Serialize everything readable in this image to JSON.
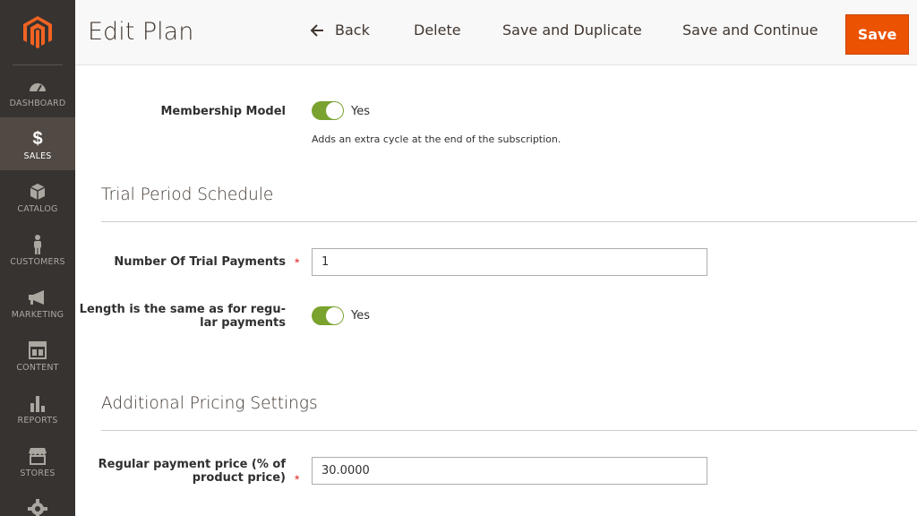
{
  "sidebar": {
    "logo": "magento-logo",
    "items": [
      {
        "label": "DASHBOARD",
        "icon": "dashboard-gauge-icon"
      },
      {
        "label": "SALES",
        "icon": "dollar-icon"
      },
      {
        "label": "CATALOG",
        "icon": "box-icon"
      },
      {
        "label": "CUSTOMERS",
        "icon": "person-icon"
      },
      {
        "label": "MARKETING",
        "icon": "megaphone-icon"
      },
      {
        "label": "CONTENT",
        "icon": "layout-icon"
      },
      {
        "label": "REPORTS",
        "icon": "bar-chart-icon"
      },
      {
        "label": "STORES",
        "icon": "storefront-icon"
      },
      {
        "label": "",
        "icon": "gear-icon"
      }
    ],
    "active_index": 1
  },
  "header": {
    "title": "Edit Plan",
    "back_label": "Back",
    "delete_label": "Delete",
    "save_duplicate_label": "Save and Duplicate",
    "save_continue_label": "Save and Continue",
    "save_label": "Save"
  },
  "form": {
    "membership": {
      "label": "Membership Model",
      "toggle_value": "Yes",
      "note": "Adds an extra cycle at the end of the subscription."
    },
    "trial_section": {
      "title": "Trial Period Schedule",
      "trial_payments_label": "Number Of Trial Payments",
      "trial_payments_value": "1",
      "length_label_line1": "Length is the same as for regu-",
      "length_label_line2": "lar payments",
      "length_toggle_value": "Yes"
    },
    "pricing_section": {
      "title": "Additional Pricing Settings",
      "regular_price_label_line1": "Regular payment price (% of",
      "regular_price_label_line2": "product price)",
      "regular_price_value": "30.0000"
    },
    "required_mark": "*"
  },
  "colors": {
    "sidebar_bg": "#373330",
    "sidebar_active": "#514943",
    "save_orange": "#eb5202",
    "toggle_green": "#79a22e",
    "required_red": "#e22626"
  }
}
